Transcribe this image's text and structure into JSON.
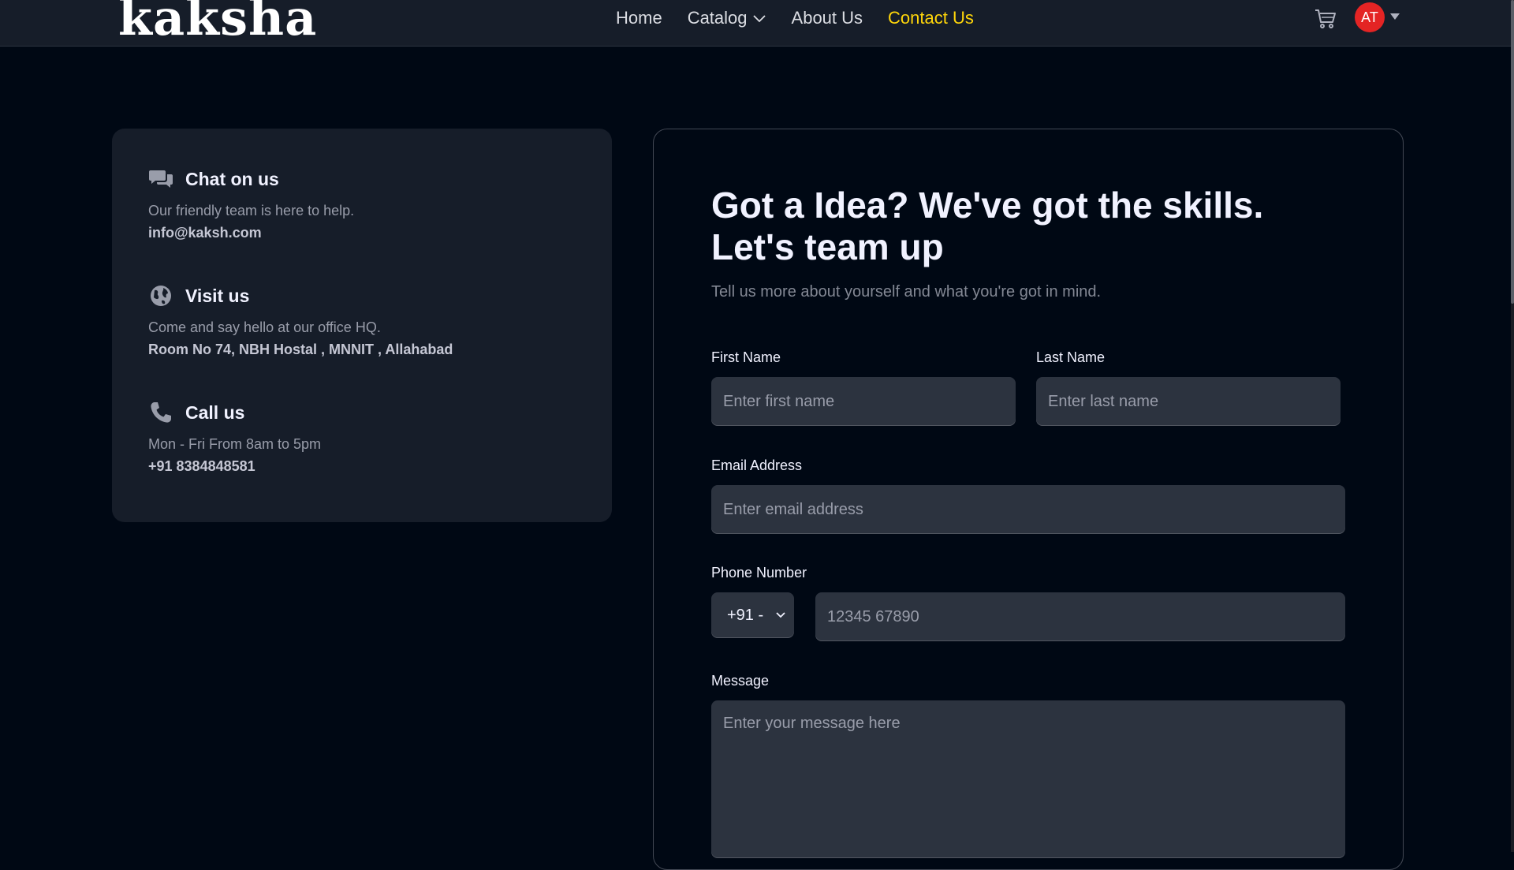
{
  "nav": {
    "logo": "kaksha",
    "links": [
      {
        "label": "Home"
      },
      {
        "label": "Catalog"
      },
      {
        "label": "About Us"
      },
      {
        "label": "Contact Us"
      }
    ],
    "avatar_initials": "AT"
  },
  "contact_info": {
    "chat": {
      "title": "Chat on us",
      "desc": "Our friendly team is here to help.",
      "detail": "info@kaksh.com"
    },
    "visit": {
      "title": "Visit us",
      "desc": "Come and say hello at our office HQ.",
      "detail": "Room No 74, NBH Hostal , MNNIT , Allahabad"
    },
    "call": {
      "title": "Call us",
      "desc": "Mon - Fri From 8am to 5pm",
      "detail": "+91 8384848581"
    }
  },
  "form": {
    "title": "Got a Idea? We've got the skills. Let's team up",
    "subtitle": "Tell us more about yourself and what you're got in mind.",
    "first_name_label": "First Name",
    "first_name_placeholder": "Enter first name",
    "last_name_label": "Last Name",
    "last_name_placeholder": "Enter last name",
    "email_label": "Email Address",
    "email_placeholder": "Enter email address",
    "phone_label": "Phone Number",
    "country_code": "+91 -",
    "phone_placeholder": "12345 67890",
    "message_label": "Message",
    "message_placeholder": "Enter your message here"
  },
  "colors": {
    "accent": "#ffd60a",
    "avatar_bg": "#e42424",
    "card_bg": "#161d29",
    "input_bg": "#2c333f",
    "page_bg": "#000814"
  },
  "icons": {
    "chat": "chat-bubbles-icon",
    "visit": "globe-icon",
    "call": "phone-icon",
    "cart": "cart-icon"
  }
}
